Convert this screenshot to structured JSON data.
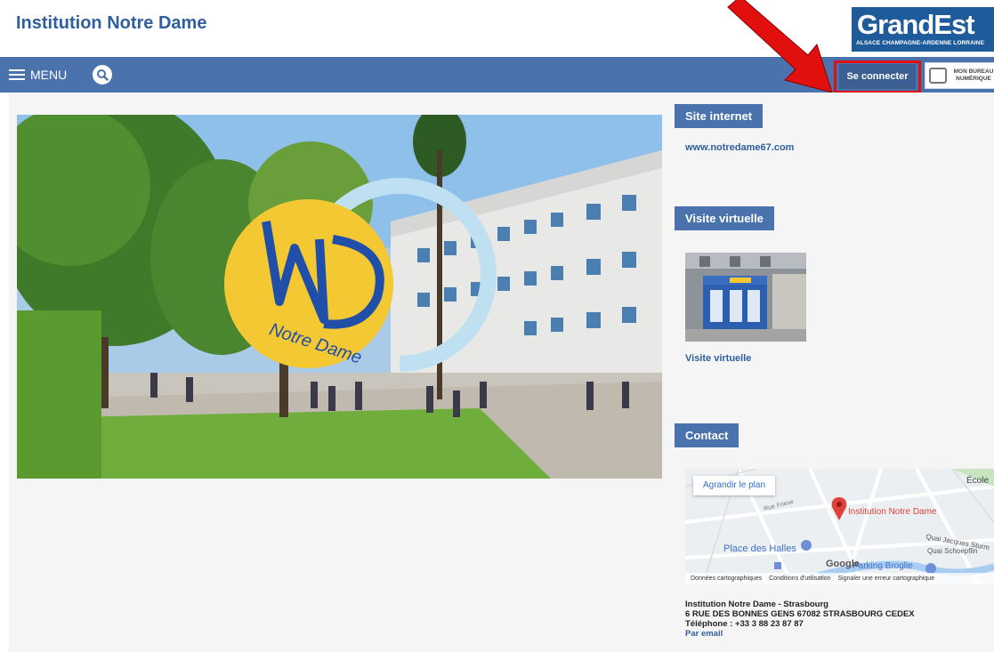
{
  "header": {
    "site_title": "Institution Notre Dame"
  },
  "logo": {
    "main": "GrandEst",
    "sub": "ALSACE CHAMPAGNE-ARDENNE LORRAINE"
  },
  "nav": {
    "menu_label": "MENU",
    "connect_label": "Se connecter",
    "bureau_line1": "MON BUREAU",
    "bureau_line2": "NUMÉRIQUE"
  },
  "hero": {
    "logo_text": "Notre Dame"
  },
  "site": {
    "section": "Site internet",
    "url": "www.notredame67.com"
  },
  "virtual": {
    "section": "Visite virtuelle",
    "link": "Visite virtuelle"
  },
  "contact": {
    "section": "Contact",
    "map": {
      "enlarge": "Agrandir le plan",
      "place": "Institution Notre Dame",
      "halles": "Place des Halles",
      "street1": "Rue Friese",
      "quai1": "Quai Jacques Sturm",
      "quai2": "Quai Schoepflin",
      "ecole": "École",
      "parking": "Parking Broglie",
      "google": "Google",
      "footer1": "Données cartographiques",
      "footer2": "Conditions d'utilisation",
      "footer3": "Signaler une erreur cartographique"
    },
    "name": "Institution Notre Dame - Strasbourg",
    "address": "6 RUE DES BONNES GENS 67082 STRASBOURG CEDEX",
    "phone": "Téléphone : +33 3 88 23 87 87",
    "email": "Par email"
  },
  "colors": {
    "nav": "#4a73ad",
    "title": "#2f5f9e",
    "highlight": "#e20f0f"
  }
}
